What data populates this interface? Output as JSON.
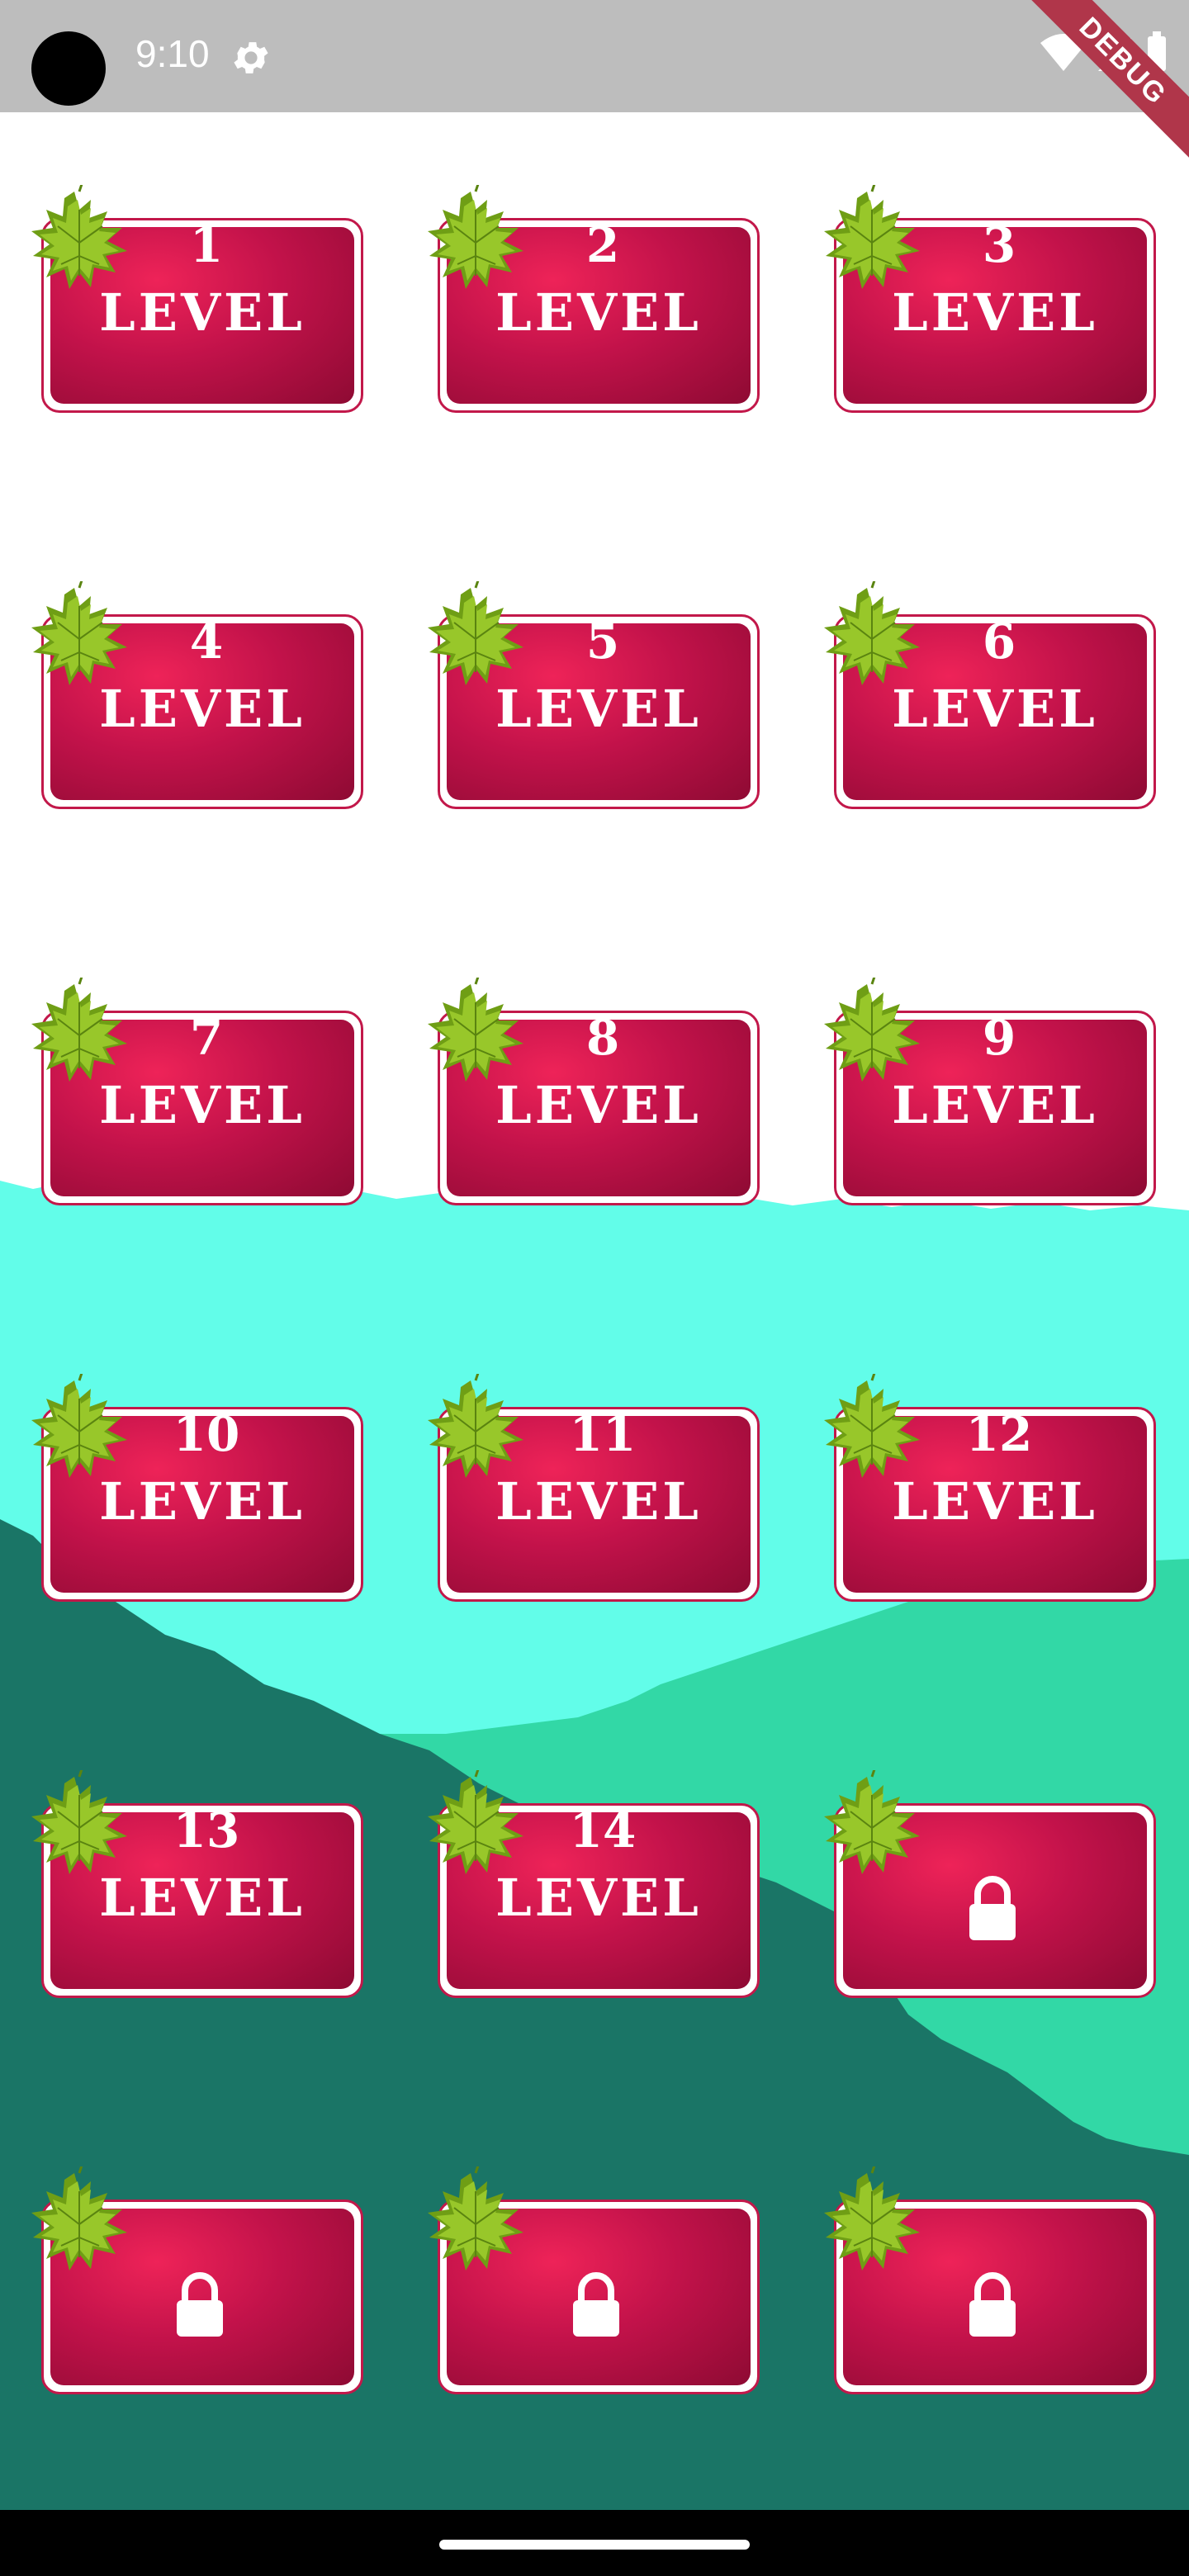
{
  "status_bar": {
    "time": "9:10",
    "debug_banner": "DEBUG"
  },
  "levels": [
    {
      "number": "1",
      "label": "LEVEL",
      "locked": false
    },
    {
      "number": "2",
      "label": "LEVEL",
      "locked": false
    },
    {
      "number": "3",
      "label": "LEVEL",
      "locked": false
    },
    {
      "number": "4",
      "label": "LEVEL",
      "locked": false
    },
    {
      "number": "5",
      "label": "LEVEL",
      "locked": false
    },
    {
      "number": "6",
      "label": "LEVEL",
      "locked": false
    },
    {
      "number": "7",
      "label": "LEVEL",
      "locked": false
    },
    {
      "number": "8",
      "label": "LEVEL",
      "locked": false
    },
    {
      "number": "9",
      "label": "LEVEL",
      "locked": false
    },
    {
      "number": "10",
      "label": "LEVEL",
      "locked": false
    },
    {
      "number": "11",
      "label": "LEVEL",
      "locked": false
    },
    {
      "number": "12",
      "label": "LEVEL",
      "locked": false
    },
    {
      "number": "13",
      "label": "LEVEL",
      "locked": false
    },
    {
      "number": "14",
      "label": "LEVEL",
      "locked": false
    },
    {
      "number": "",
      "label": "",
      "locked": true
    },
    {
      "number": "",
      "label": "",
      "locked": true
    },
    {
      "number": "",
      "label": "",
      "locked": true
    },
    {
      "number": "",
      "label": "",
      "locked": true
    }
  ],
  "icons": {
    "settings": "gear-icon",
    "wifi": "wifi-icon",
    "signal": "signal-icon",
    "battery": "battery-icon",
    "leaf": "maple-leaf-icon",
    "lock": "lock-icon"
  },
  "colors": {
    "card_light": "#ee2358",
    "card_dark": "#8e0a33",
    "sky_light": "#62fde9",
    "hill_mid": "#32d8a6",
    "hill_dark": "#1a7566",
    "leaf": "#8cbd24"
  }
}
